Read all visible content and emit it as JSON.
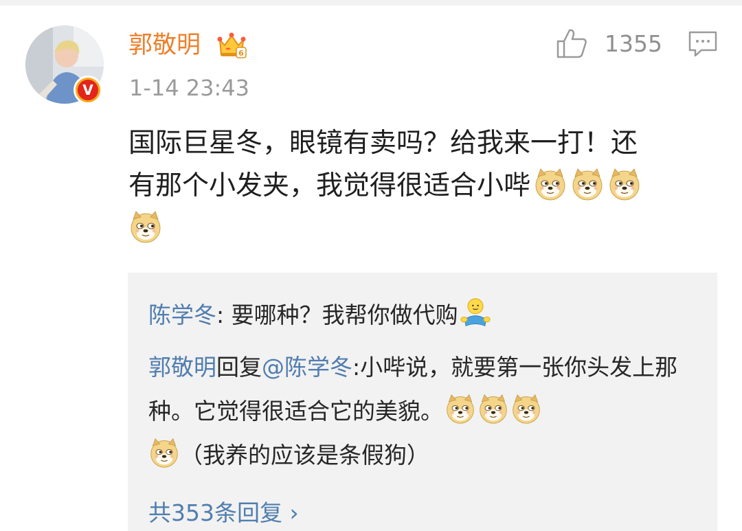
{
  "post": {
    "username": "郭敬明",
    "timestamp": "1-14 23:43",
    "like_count": "1355",
    "verified_badge": "V",
    "crown_level": "6",
    "content_line1": "国际巨星冬，眼镜有卖吗？给我来一打！还",
    "content_line2": "有那个小发夹，我觉得很适合小哔",
    "content_emojis": [
      "doge-emoji",
      "doge-emoji",
      "doge-emoji",
      "doge-emoji"
    ]
  },
  "replies": [
    {
      "author": "陈学冬",
      "separator": ":",
      "text": " 要哪种？我帮你做代购",
      "emoji": "hug-emoji"
    },
    {
      "author": "郭敬明",
      "reply_word": "回复",
      "mention": "@陈学冬",
      "separator": ":",
      "text_part1": "小哔说，就要第一张你头发上那种。它觉得很适合它的美貌。",
      "text_part2": "（我养的应该是条假狗）",
      "emojis": [
        "doge-emoji",
        "doge-emoji",
        "doge-emoji",
        "doge-emoji"
      ]
    }
  ],
  "more_replies": {
    "label": "共353条回复",
    "arrow": "›"
  },
  "colors": {
    "username": "#f07f2a",
    "link_blue": "#507daf",
    "meta_gray": "#9a9a9a",
    "reply_bg": "#f2f2f2",
    "badge_red": "#e3251b",
    "badge_ring": "#f6a81d"
  },
  "icons": {
    "like": "thumbs-up-icon",
    "comment": "comment-bubble-icon",
    "crown": "crown-vip-icon"
  }
}
